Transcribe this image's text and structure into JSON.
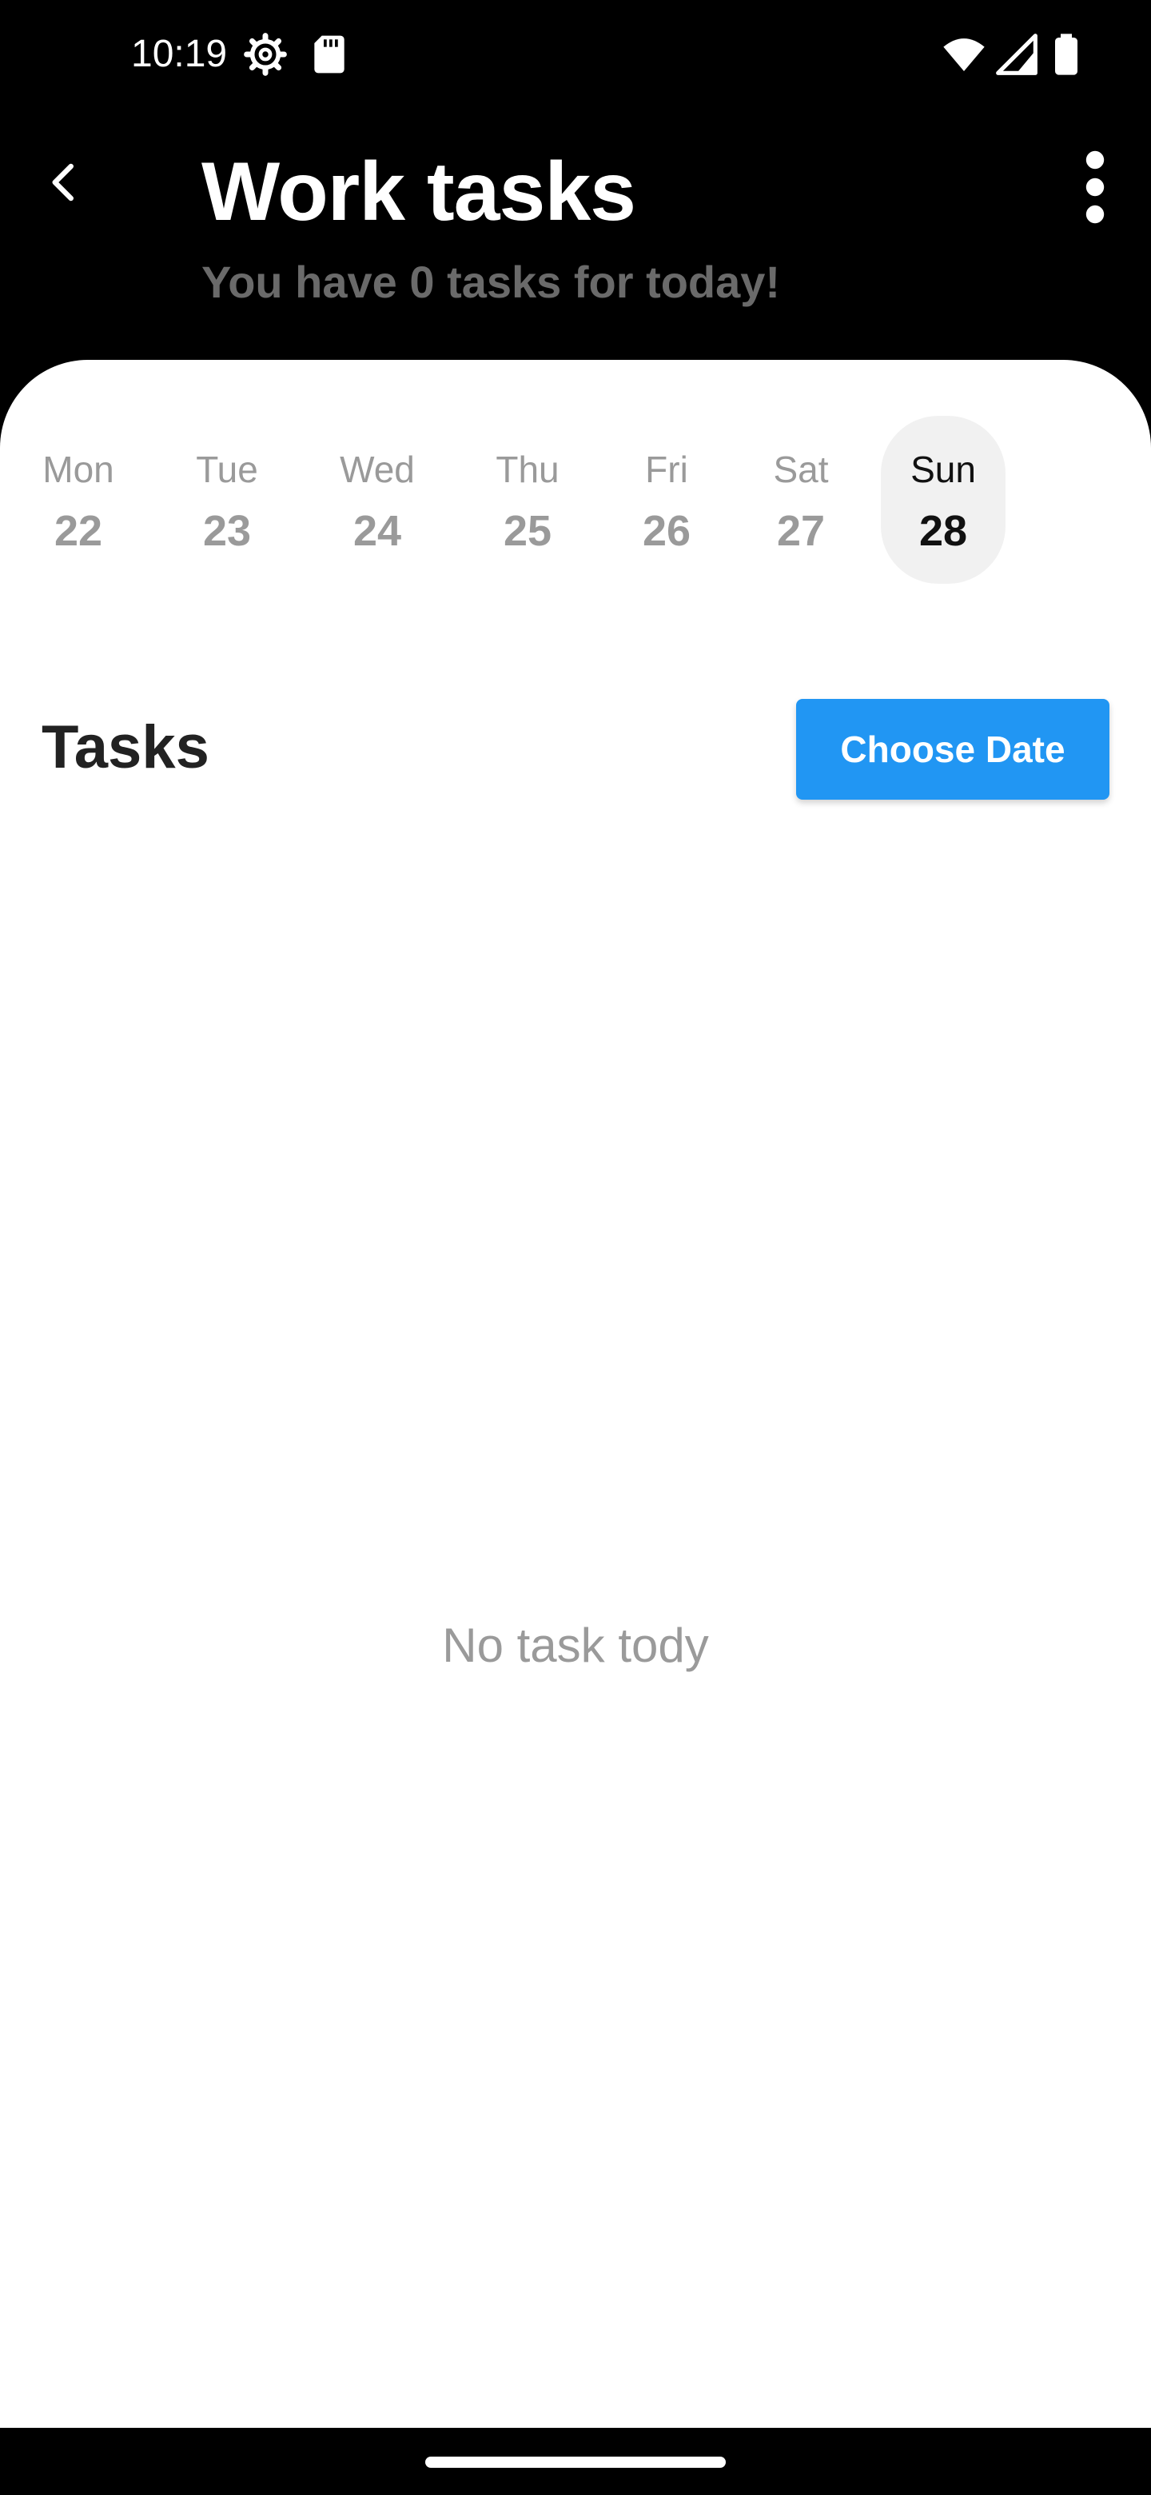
{
  "status_bar": {
    "time": "10:19",
    "icons": [
      "gear-icon",
      "sd-card-icon",
      "wifi-icon",
      "signal-icon",
      "battery-icon"
    ]
  },
  "header": {
    "title": "Work tasks",
    "subtitle": "You have 0 tasks for today!",
    "back_icon": "chevron-left-icon",
    "menu_icon": "more-vertical-icon"
  },
  "week": {
    "days": [
      {
        "name": "Mon",
        "date": "22"
      },
      {
        "name": "Tue",
        "date": "23"
      },
      {
        "name": "Wed",
        "date": "24"
      },
      {
        "name": "Thu",
        "date": "25"
      },
      {
        "name": "Fri",
        "date": "26"
      },
      {
        "name": "Sat",
        "date": "27"
      },
      {
        "name": "Sun",
        "date": "28"
      }
    ],
    "selected_day": "Sun 28"
  },
  "tasks": {
    "heading": "Tasks",
    "choose_date_label": "Choose Date",
    "empty_message": "No task tody"
  },
  "colors": {
    "accent": "#2196f3",
    "header_bg": "#000000",
    "subtitle": "#6a6a6a",
    "muted_text": "#9a9a9a",
    "selected_day_bg": "#f1f1f1"
  }
}
